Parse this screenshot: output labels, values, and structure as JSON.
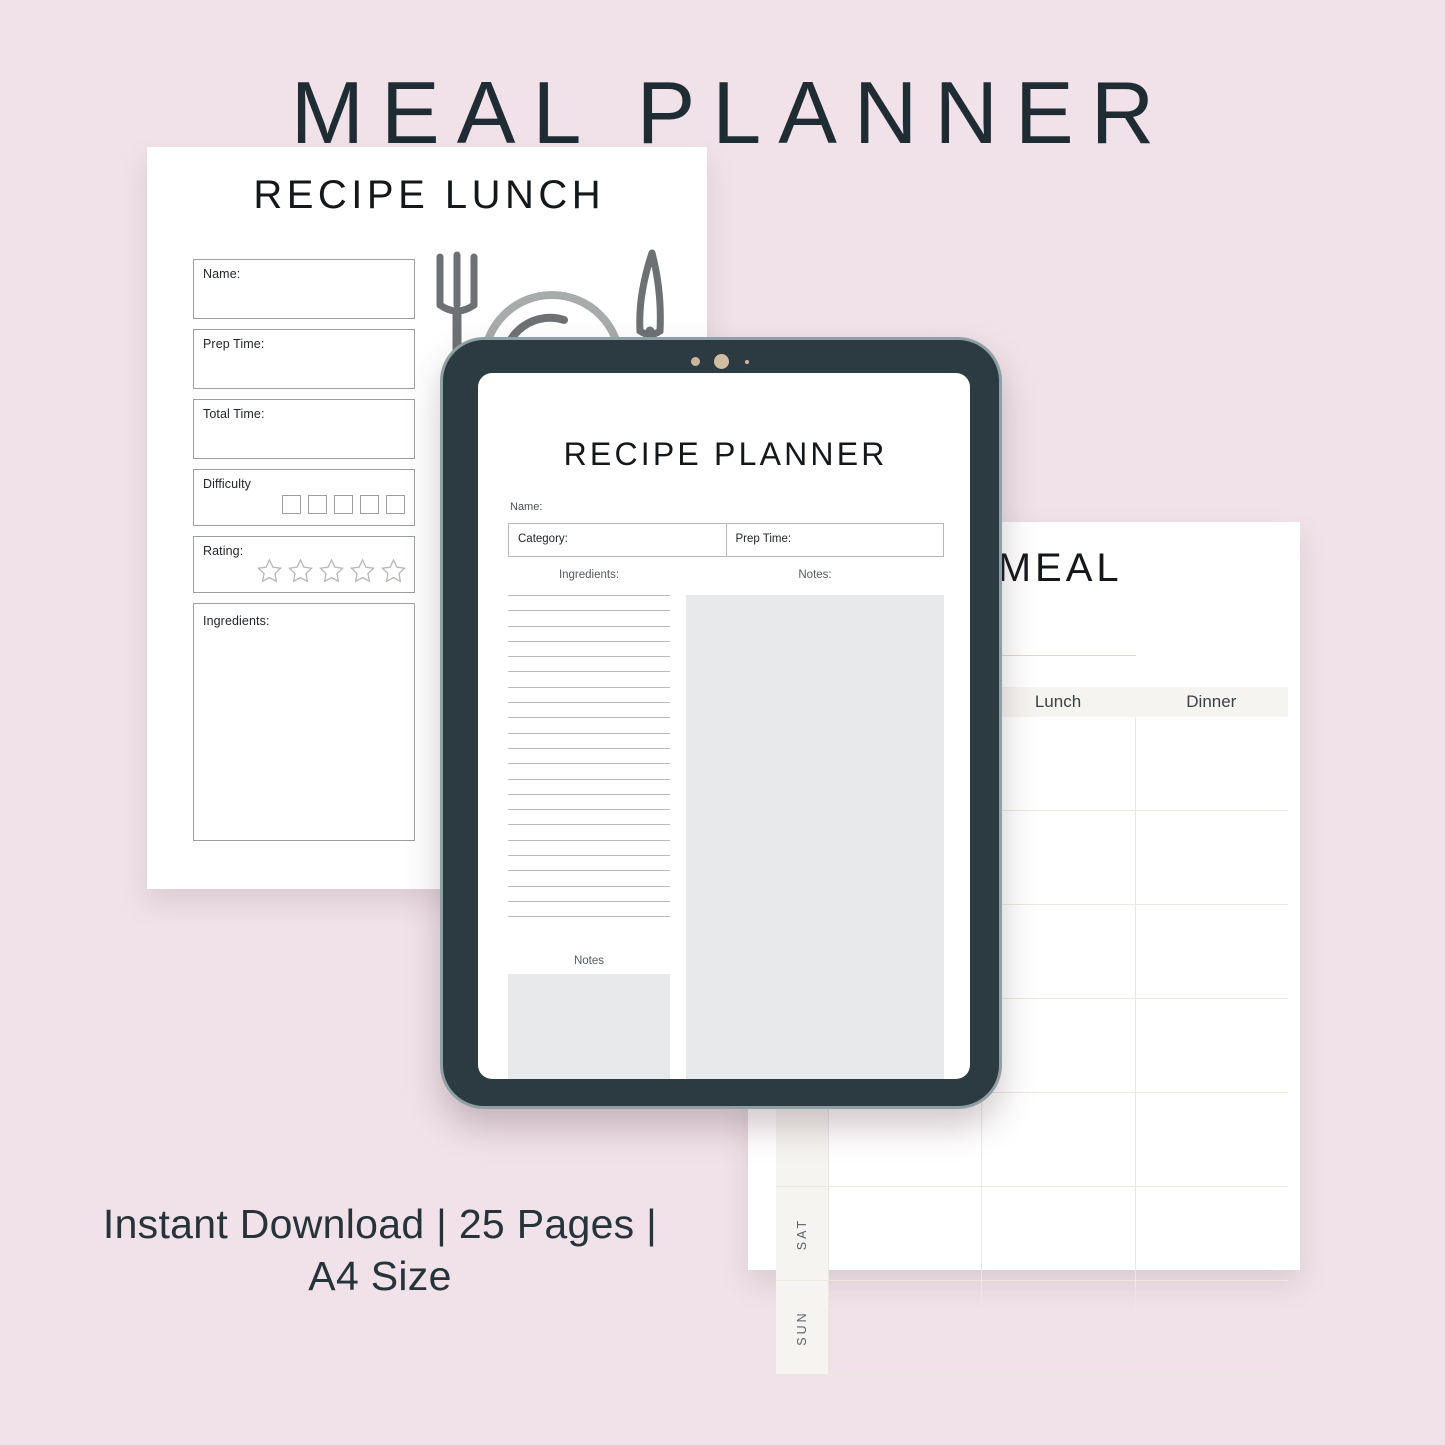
{
  "background_color": "#f0e2e8",
  "header": {
    "title": "MEAL PLANNER"
  },
  "footer": {
    "caption_line1": "Instant Download | 25 Pages |",
    "caption_line2": "A4 Size"
  },
  "pages": {
    "recipe_lunch": {
      "title": "RECIPE LUNCH",
      "fields": [
        {
          "label": "Name:",
          "type": "text"
        },
        {
          "label": "Prep Time:",
          "type": "text"
        },
        {
          "label": "Total Time:",
          "type": "text"
        },
        {
          "label": "Difficulty",
          "type": "checkboxes",
          "count": 5
        },
        {
          "label": "Rating:",
          "type": "stars",
          "count": 5
        },
        {
          "label": "Ingredients:",
          "type": "textarea"
        }
      ]
    },
    "recipe_planner": {
      "title": "RECIPE PLANNER",
      "name_label": "Name:",
      "category_label": "Category:",
      "prep_time_label": "Prep Time:",
      "ingredients_label": "Ingredients:",
      "notes_label": "Notes:",
      "notes_small_label": "Notes",
      "ingredient_line_count": 22
    },
    "weekly_meal": {
      "title": "LY MEAL",
      "full_title": "WEEKLY MEAL",
      "columns": [
        "Lunch",
        "Dinner"
      ],
      "visible_days": [
        "SAT",
        "SUN"
      ],
      "row_count": 7
    }
  },
  "device": {
    "name": "tablet",
    "bezel_color": "#2b3b41",
    "edge_color": "#8ea0a3",
    "sensors": [
      "camera-sensor-small",
      "camera-lens",
      "camera-sensor-dark"
    ]
  },
  "illustration": {
    "name": "cutlery-plate-icon",
    "parts": [
      "fork-icon",
      "plate-icon",
      "knife-icon"
    ],
    "fork_color": "#6e7173",
    "knife_color": "#6e7173",
    "plate_outer_color": "#a8abac",
    "plate_inner_color": "#6e7173"
  }
}
